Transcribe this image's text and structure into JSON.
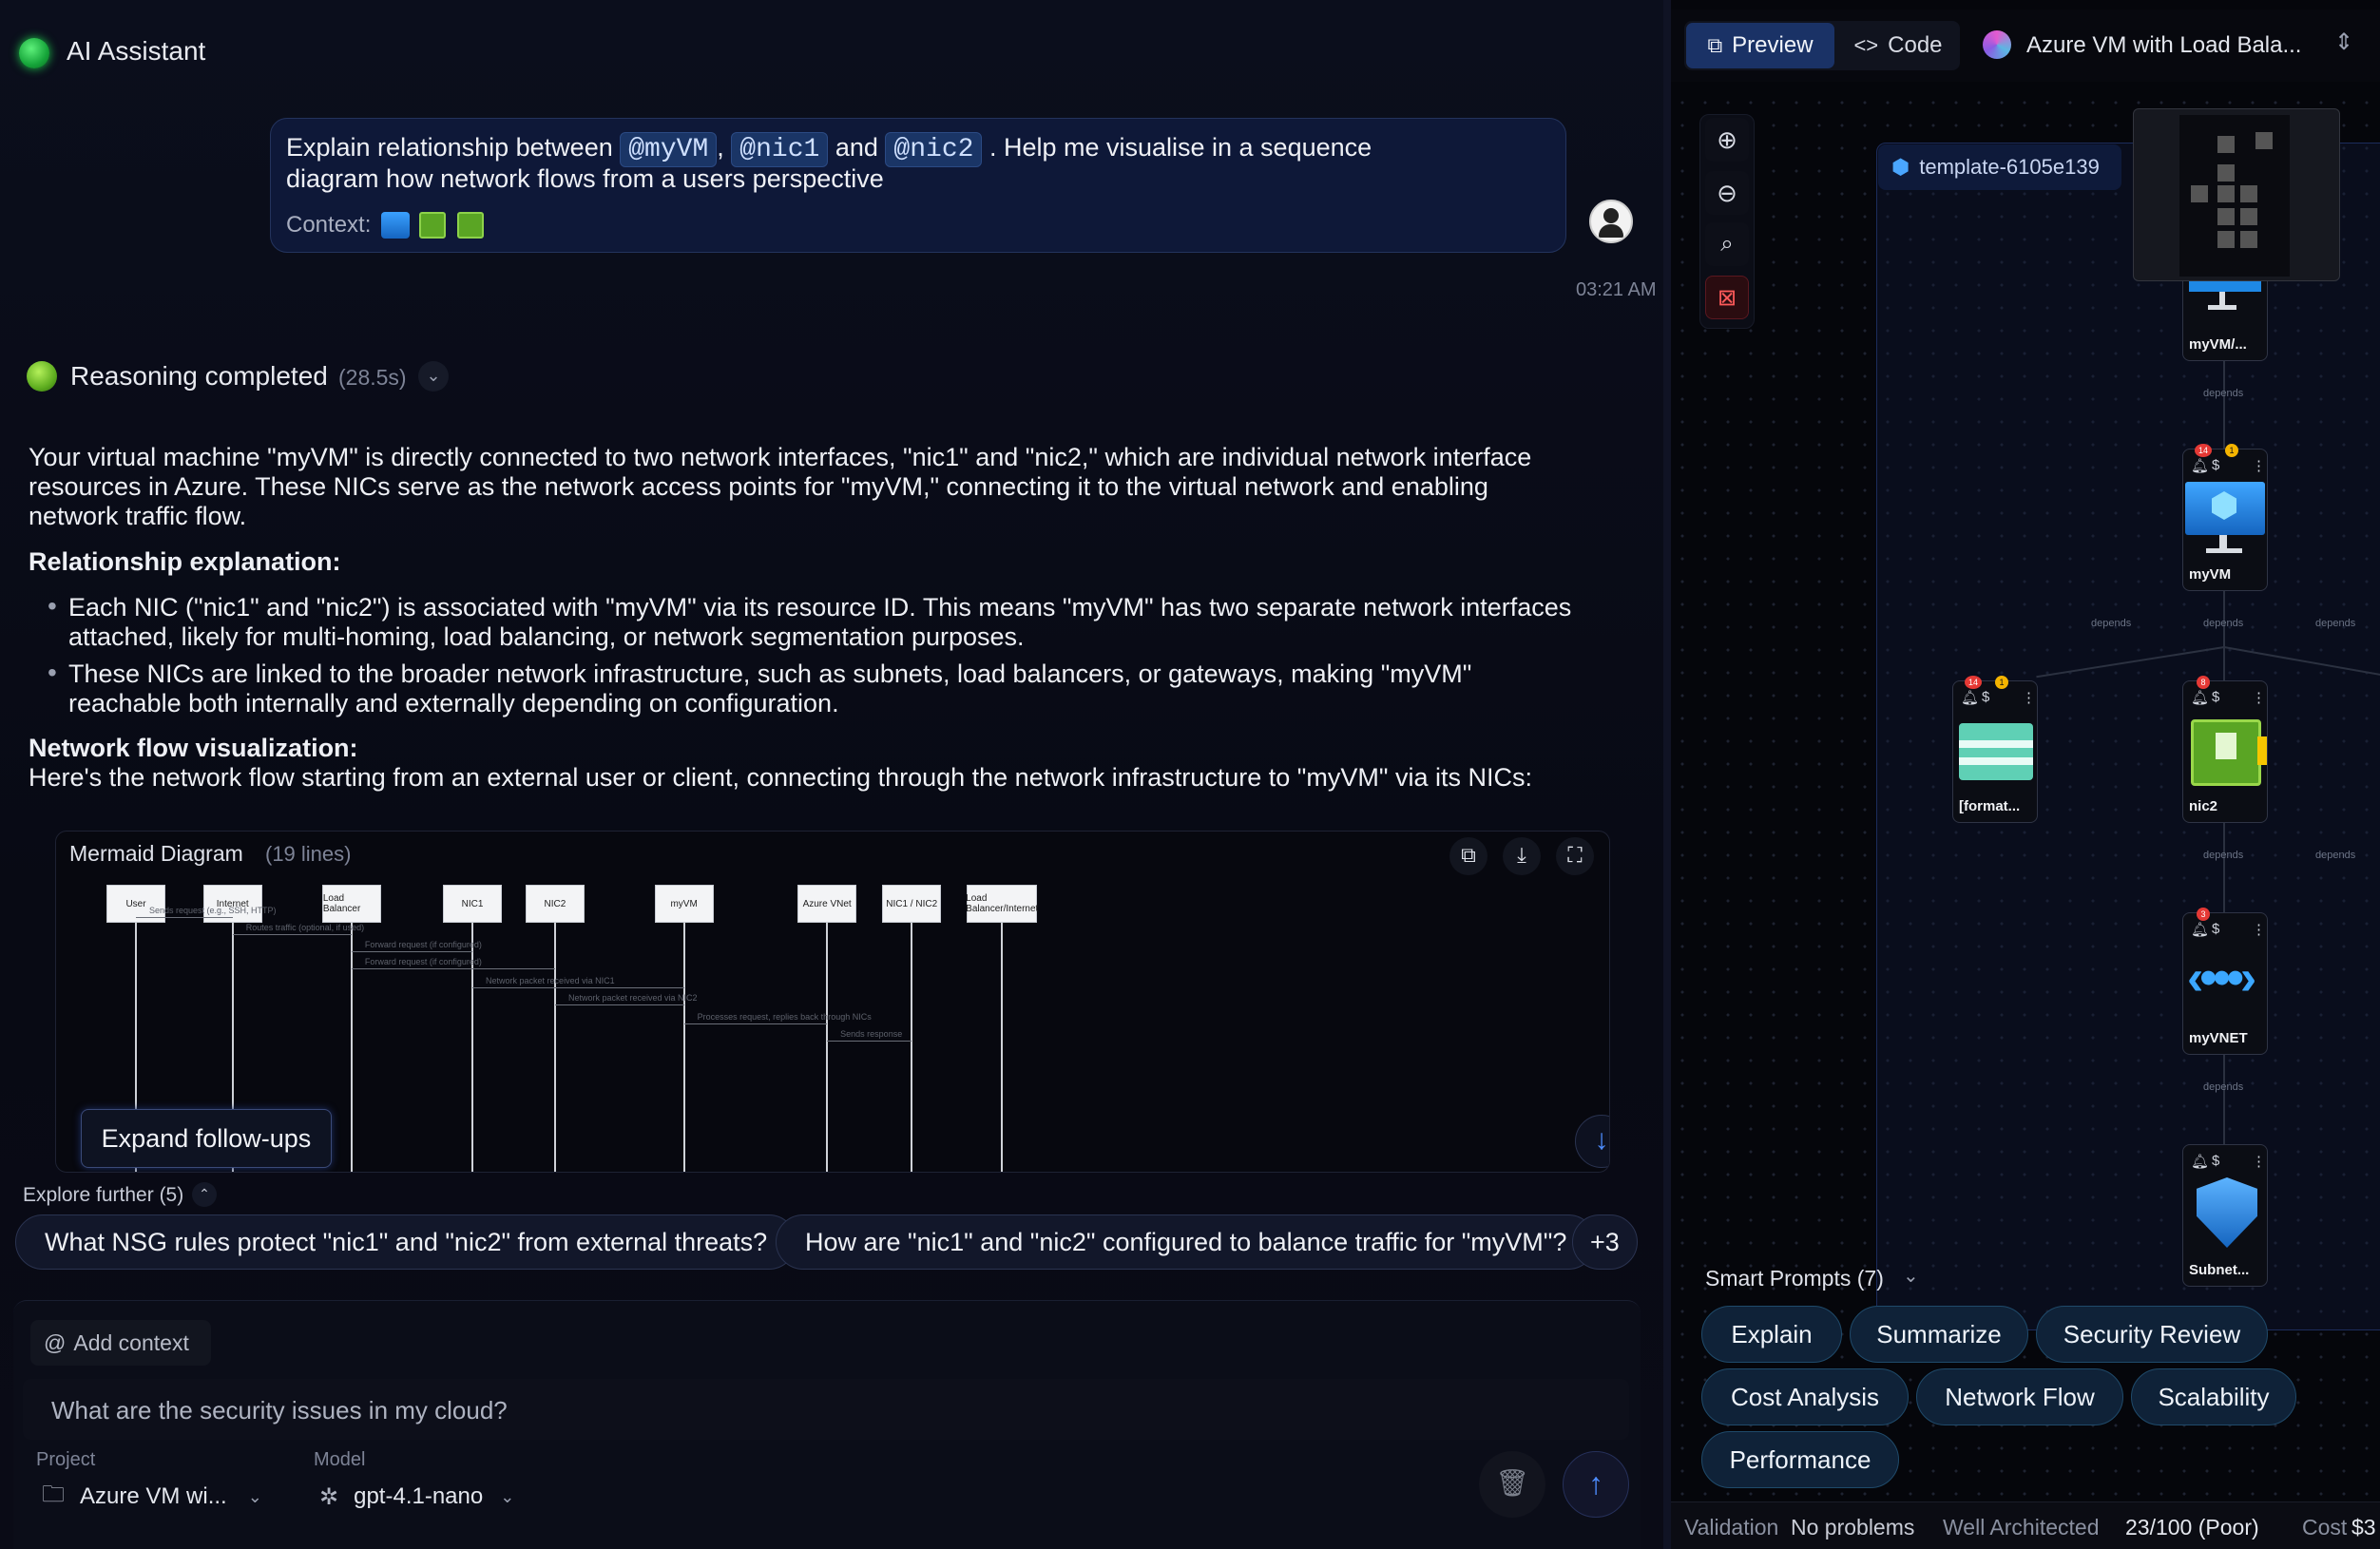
{
  "assistant": {
    "title": "AI Assistant"
  },
  "user_message": {
    "pre": "Explain relationship between",
    "m1": "@myVM",
    "comma": ",",
    "m2": "@nic1",
    "and": "and",
    "m3": "@nic2",
    "post": ". Help me visualise in a sequence",
    "line2": "diagram how network flows from a users perspective",
    "context_label": "Context:",
    "time": "03:21 AM"
  },
  "reasoning": {
    "label": "Reasoning completed",
    "duration": "(28.5s)"
  },
  "response": {
    "p1": [
      "Your virtual machine \"myVM\" is directly connected to two network interfaces, \"nic1\" and \"nic2,\" which are individual network interface",
      "resources in Azure. These NICs serve as the network access points for \"myVM,\" connecting it to the virtual network and enabling",
      "network traffic flow."
    ],
    "h1": "Relationship explanation:",
    "b1": [
      "Each NIC (\"nic1\" and \"nic2\") is associated with \"myVM\" via its resource ID. This means \"myVM\" has two separate network interfaces",
      "attached, likely for multi-homing, load balancing, or network segmentation purposes."
    ],
    "b2": [
      "These NICs are linked to the broader network infrastructure, such as subnets, load balancers, or gateways, making \"myVM\"",
      "reachable both internally and externally depending on configuration."
    ],
    "h2": "Network flow visualization:",
    "p2": "Here's the network flow starting from an external user or client, connecting through the network infrastructure to \"myVM\" via its NICs:"
  },
  "diagram": {
    "title": "Mermaid Diagram",
    "lines": "(19 lines)",
    "actors": [
      "User",
      "Internet",
      "Load Balancer",
      "NIC1",
      "NIC2",
      "myVM",
      "Azure VNet",
      "NIC1 / NIC2",
      "Load Balancer/Internet"
    ],
    "messages": [
      "Sends request (e.g., SSH, HTTP)",
      "Routes traffic (optional, if used)",
      "Forward request (if configured)",
      "Forward request (if configured)",
      "Network packet received via NIC1",
      "Network packet received via NIC2",
      "Processes request, replies back through NICs",
      "Sends response"
    ],
    "expand_label": "Expand follow-ups"
  },
  "explore": {
    "label": "Explore further (5)",
    "chips": [
      "What NSG rules protect \"nic1\" and \"nic2\" from external threats?",
      "How are \"nic1\" and \"nic2\" configured to balance traffic for \"myVM\"?",
      "+3"
    ]
  },
  "composer": {
    "add_context": "Add context",
    "placeholder": "What are the security issues in my cloud?",
    "project_label": "Project",
    "project_value": "Azure VM wi...",
    "model_label": "Model",
    "model_value": "gpt-4.1-nano"
  },
  "right": {
    "tabs": {
      "preview": "Preview",
      "code": "Code"
    },
    "project_title": "Azure VM with Load Bala...",
    "template": "template-6105e139",
    "nodes": {
      "n1": "myVM/...",
      "n2": "myVM",
      "n3": "[format...",
      "n4": "nic2",
      "n5": "myVNET",
      "n6": "Subnet..."
    },
    "badges": {
      "b14a": "14",
      "b1a": "1",
      "b14b": "14",
      "b1b": "1",
      "b8": "8",
      "b3": "3"
    },
    "depends": "depends",
    "smart_prompts": "Smart Prompts (7)",
    "prompts": [
      "Explain",
      "Summarize",
      "Security Review",
      "Cost Analysis",
      "Network Flow",
      "Scalability",
      "Performance"
    ],
    "status": {
      "validation_label": "Validation",
      "validation_value": "No problems",
      "wa_label": "Well Architected",
      "wa_value": "23/100 (Poor)",
      "cost_label": "Cost",
      "cost_value": "$3"
    }
  }
}
